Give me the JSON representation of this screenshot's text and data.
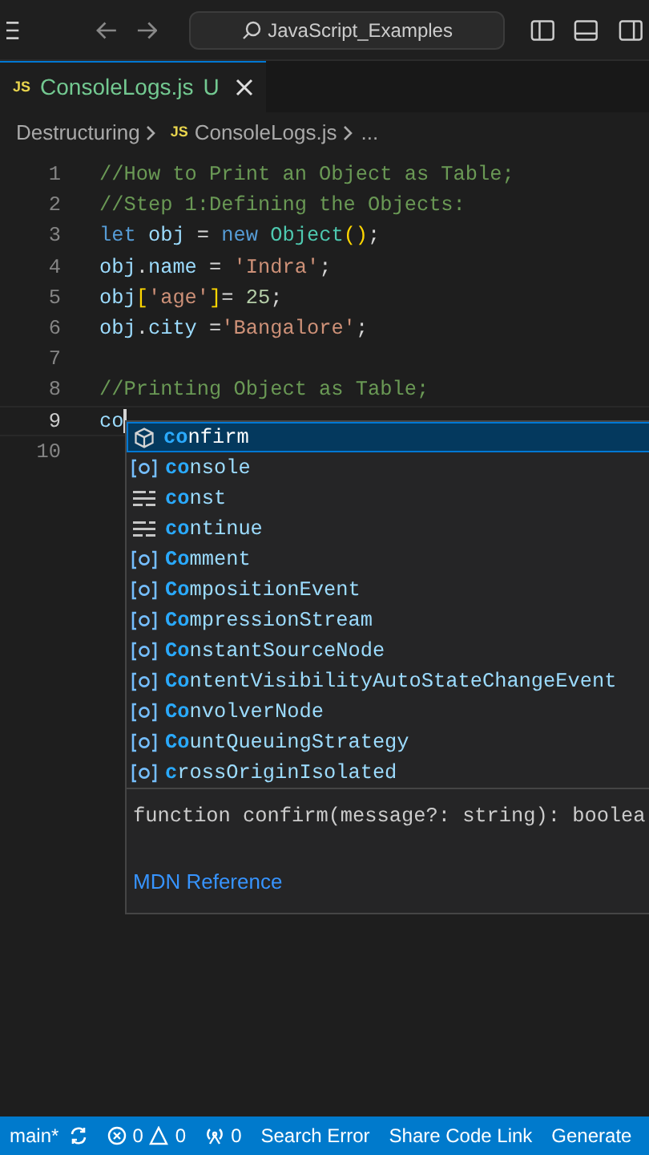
{
  "title_bar": {
    "search": {
      "value": "JavaScript_Examples"
    }
  },
  "tabs": [
    {
      "label": "ConsoleLogs.js",
      "badge": "JS",
      "status": "U",
      "selected": true
    }
  ],
  "breadcrumb": [
    {
      "label": "Destructuring",
      "kind": "folder"
    },
    {
      "label": "ConsoleLogs.js",
      "kind": "file",
      "badge": "JS"
    },
    {
      "label": "...",
      "kind": "more"
    }
  ],
  "editor": {
    "lines": [
      {
        "number": "1",
        "tokens": [
          {
            "text": "//How to Print an Object as Table;",
            "kind": "comment"
          }
        ]
      },
      {
        "number": "2",
        "tokens": [
          {
            "text": "//Step 1:Defining the Objects:",
            "kind": "comment"
          }
        ]
      },
      {
        "number": "3",
        "tokens": [
          {
            "text": "let ",
            "kind": "keyword"
          },
          {
            "text": "obj",
            "kind": "var"
          },
          {
            "text": " = ",
            "kind": "plain"
          },
          {
            "text": "new ",
            "kind": "keyword"
          },
          {
            "text": "Object",
            "kind": "class"
          },
          {
            "text": "()",
            "kind": "bracket"
          },
          {
            "text": ";",
            "kind": "plain"
          }
        ]
      },
      {
        "number": "4",
        "tokens": [
          {
            "text": "obj",
            "kind": "var"
          },
          {
            "text": ".",
            "kind": "plain"
          },
          {
            "text": "name",
            "kind": "var"
          },
          {
            "text": " = ",
            "kind": "plain"
          },
          {
            "text": "'Indra'",
            "kind": "string"
          },
          {
            "text": ";",
            "kind": "plain"
          }
        ]
      },
      {
        "number": "5",
        "tokens": [
          {
            "text": "obj",
            "kind": "var"
          },
          {
            "text": "[",
            "kind": "bracket"
          },
          {
            "text": "'age'",
            "kind": "string"
          },
          {
            "text": "]",
            "kind": "bracket"
          },
          {
            "text": "= ",
            "kind": "plain"
          },
          {
            "text": "25",
            "kind": "number"
          },
          {
            "text": ";",
            "kind": "plain"
          }
        ]
      },
      {
        "number": "6",
        "tokens": [
          {
            "text": "obj",
            "kind": "var"
          },
          {
            "text": ".",
            "kind": "plain"
          },
          {
            "text": "city",
            "kind": "var"
          },
          {
            "text": " =",
            "kind": "plain"
          },
          {
            "text": "'Bangalore'",
            "kind": "string"
          },
          {
            "text": ";",
            "kind": "plain"
          }
        ]
      },
      {
        "number": "7"
      },
      {
        "number": "8",
        "tokens": [
          {
            "text": "//Printing Object as Table;",
            "kind": "comment"
          }
        ]
      },
      {
        "number": "9",
        "current": true,
        "tokens": [
          {
            "text": "co",
            "kind": "var"
          }
        ]
      },
      {
        "number": "10"
      }
    ]
  },
  "suggestions": {
    "items": [
      {
        "match": "co",
        "rest": "nfirm",
        "kind": "function",
        "selected": true
      },
      {
        "match": "co",
        "rest": "nsole",
        "kind": "variable",
        "selected": false
      },
      {
        "match": "co",
        "rest": "nst",
        "kind": "keyword",
        "selected": false
      },
      {
        "match": "co",
        "rest": "ntinue",
        "kind": "keyword",
        "selected": false
      },
      {
        "match": "Co",
        "rest": "mment",
        "kind": "variable",
        "selected": false
      },
      {
        "match": "Co",
        "rest": "mpositionEvent",
        "kind": "variable",
        "selected": false
      },
      {
        "match": "Co",
        "rest": "mpressionStream",
        "kind": "variable",
        "selected": false
      },
      {
        "match": "Co",
        "rest": "nstantSourceNode",
        "kind": "variable",
        "selected": false
      },
      {
        "match": "Co",
        "rest": "ntentVisibilityAutoStateChangeEvent",
        "kind": "variable",
        "selected": false
      },
      {
        "match": "Co",
        "rest": "nvolverNode",
        "kind": "variable",
        "selected": false
      },
      {
        "match": "Co",
        "rest": "untQueuingStrategy",
        "kind": "variable",
        "selected": false
      },
      {
        "match": "c",
        "rest": "rossOriginIsolated",
        "kind": "variable",
        "selected": false
      }
    ],
    "detail": {
      "signature": "function confirm(message?: string): boolea",
      "link": "MDN Reference"
    }
  },
  "status_bar": {
    "branch": "main*",
    "errors": "0",
    "warnings": "0",
    "ports": "0",
    "items": [
      "Search Error",
      "Share Code Link",
      "Generate"
    ]
  }
}
